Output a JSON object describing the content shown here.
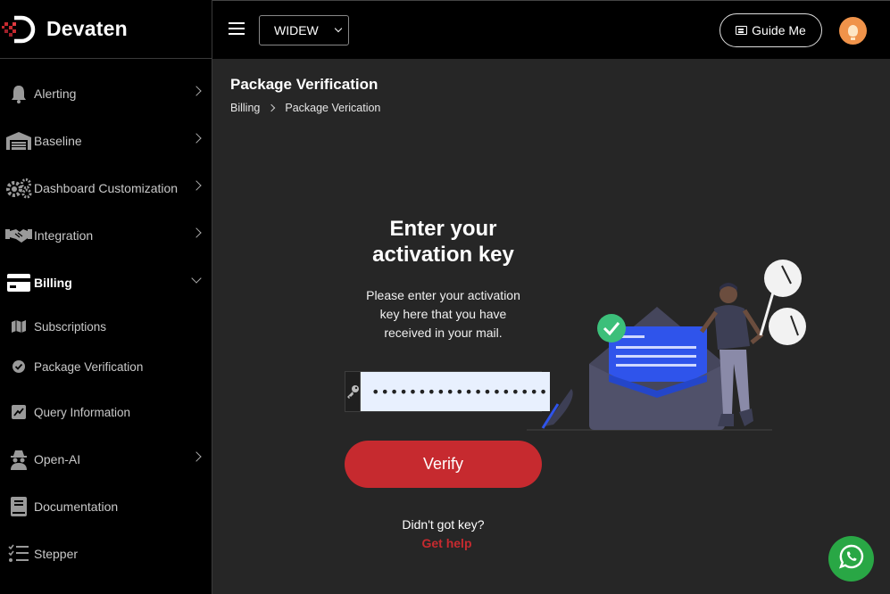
{
  "brand": {
    "name": "Devaten"
  },
  "header": {
    "select_value": "WIDEW",
    "guide_label": "Guide Me"
  },
  "sidebar": {
    "items": [
      {
        "label": "Alerting",
        "icon": "bell-icon"
      },
      {
        "label": "Baseline",
        "icon": "warehouse-icon"
      },
      {
        "label": "Dashboard Customization",
        "icon": "gears-icon"
      },
      {
        "label": "Integration",
        "icon": "handshake-icon"
      },
      {
        "label": "Billing",
        "icon": "credit-card-icon"
      },
      {
        "label": "Subscriptions",
        "icon": "map-icon"
      },
      {
        "label": "Package Verification",
        "icon": "check-circle-icon"
      },
      {
        "label": "Query Information",
        "icon": "chart-icon"
      },
      {
        "label": "Open-AI",
        "icon": "spy-icon"
      },
      {
        "label": "Documentation",
        "icon": "book-icon"
      },
      {
        "label": "Stepper",
        "icon": "list-check-icon"
      }
    ]
  },
  "main": {
    "title": "Package Verification",
    "breadcrumb": [
      "Billing",
      "Package Verication"
    ],
    "heading_line1": "Enter your",
    "heading_line2": "activation key",
    "desc_line1": "Please enter your activation",
    "desc_line2": "key here that you have",
    "desc_line3": "received in your mail.",
    "key_value": "•••••••••••••••••••••••••",
    "verify_label": "Verify",
    "no_key_text": "Didn't got key?",
    "help_link": "Get help"
  },
  "colors": {
    "accent": "#c62a2f",
    "sidebar_bg": "#000000",
    "main_bg": "#262626",
    "whatsapp": "#29a745"
  }
}
